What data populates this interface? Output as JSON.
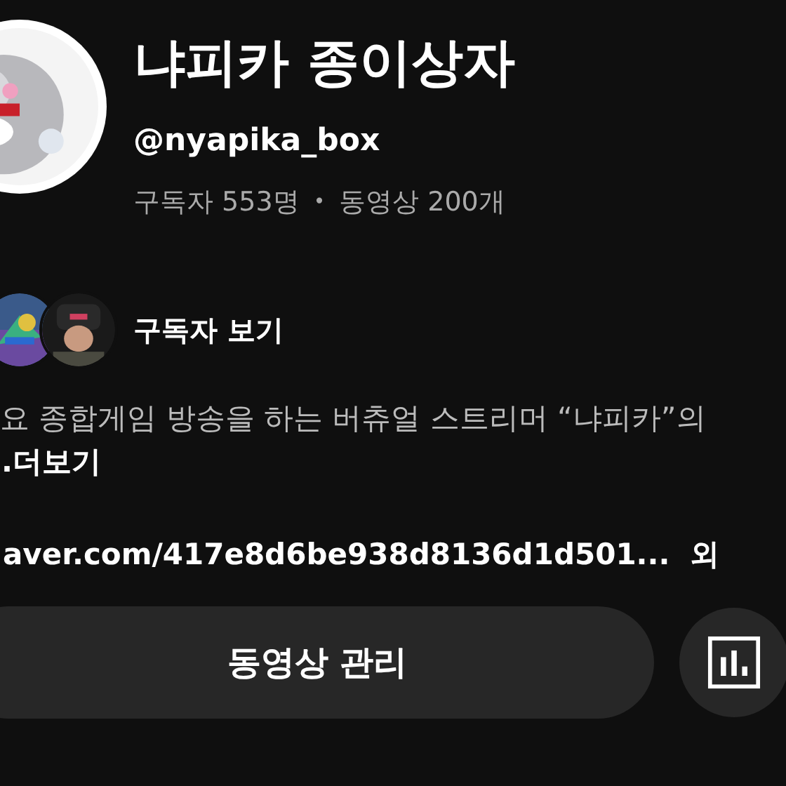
{
  "channel": {
    "name": "냐피카 종이상자",
    "handle": "@nyapika_box",
    "subscribers": "구독자 553명",
    "separator": "•",
    "videos": "동영상 200개"
  },
  "subscriber_preview": {
    "label": "구독자 보기"
  },
  "description": {
    "text": "요 종합게임 방송을 하는 버츄얼 스트리머 “냐피카”의",
    "more": ".더보기"
  },
  "link": {
    "url": "aver.com/417e8d6be938d8136d1d501...",
    "extra": "외"
  },
  "buttons": [
    {
      "kind": "text",
      "label": "동영상 관리"
    },
    {
      "kind": "analytics"
    }
  ]
}
